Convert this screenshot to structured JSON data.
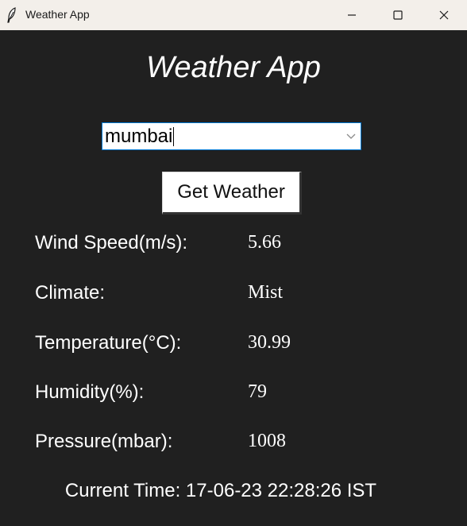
{
  "window": {
    "title": "Weather App"
  },
  "app": {
    "heading": "Weather App",
    "city_input": {
      "value": "mumbai"
    },
    "get_weather_label": "Get Weather",
    "rows": [
      {
        "label": "Wind Speed(m/s):",
        "value": "5.66"
      },
      {
        "label": "Climate:",
        "value": "Mist"
      },
      {
        "label": "Temperature(°C):",
        "value": "30.99"
      },
      {
        "label": "Humidity(%):",
        "value": "79"
      },
      {
        "label": "Pressure(mbar):",
        "value": "1008"
      }
    ],
    "current_time": "Current Time: 17-06-23 22:28:26 IST"
  },
  "icons": {
    "app": "feather-icon",
    "minimize": "minimize-icon",
    "maximize": "maximize-icon",
    "close": "close-icon",
    "dropdown": "chevron-down-icon"
  },
  "colors": {
    "background": "#202020",
    "titlebar": "#f3efea",
    "text": "#ffffff",
    "focus_border": "#0078d4"
  }
}
